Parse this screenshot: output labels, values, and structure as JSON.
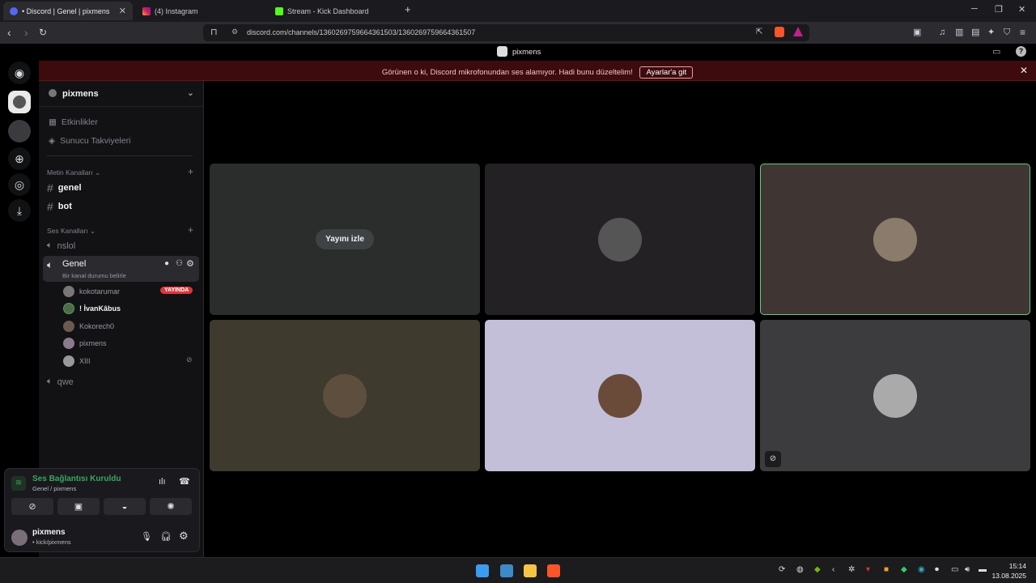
{
  "browser": {
    "tabs": [
      {
        "title": "• Discord | Genel | pixmens",
        "close": "✕"
      },
      {
        "title": "(4) Instagram"
      },
      {
        "title": "Stream - Kick Dashboard"
      }
    ],
    "new_tab": "+",
    "url": "discord.com/channels/1360269759664361503/1360269759664361507",
    "icons": [
      "back-icon",
      "forward-icon",
      "reload-icon",
      "bookmark-icon",
      "site-info-icon",
      "share-icon",
      "brave-shields-icon",
      "brave-rewards-icon",
      "screenshot-icon",
      "media-icon",
      "sidebar-icon",
      "wallet-icon",
      "leo-ai-icon",
      "vpn-icon",
      "menu-icon"
    ]
  },
  "discord": {
    "top_title": "pixmens",
    "notice": {
      "text": "Görünen o ki, Discord mikrofonundan ses alamıyor. Hadi bunu düzeltelim!",
      "button": "Ayarlar'a git"
    },
    "guild": {
      "name": "pixmens"
    },
    "sidebar": {
      "items": [
        {
          "label": "Etkinlikler"
        },
        {
          "label": "Sunucu Takviyeleri"
        }
      ],
      "text_category": "Metin Kanalları",
      "text_channels": [
        "genel",
        "bot"
      ],
      "voice_category": "Ses Kanalları",
      "voice_channels": [
        "nslol",
        "Genel",
        "qwe"
      ],
      "active_status": "Bir kanal durumu belirle",
      "members": [
        {
          "name": "kokotarumar",
          "badge": "YAYINDA"
        },
        {
          "name": "! İvanKâbus"
        },
        {
          "name": "Kokorech0"
        },
        {
          "name": "pixmens"
        },
        {
          "name": "XIII"
        }
      ]
    },
    "voice": {
      "status": "Ses Bağlantısı Kuruldu",
      "location": "Genel / pixmens",
      "accent": "#3ba55d"
    },
    "user": {
      "name": "pixmens",
      "status": "• kick/pixmens"
    },
    "stage": {
      "watch_label": "Yayını izle"
    }
  },
  "taskbar": {
    "time": "15:14",
    "date": "13.08.2025"
  }
}
